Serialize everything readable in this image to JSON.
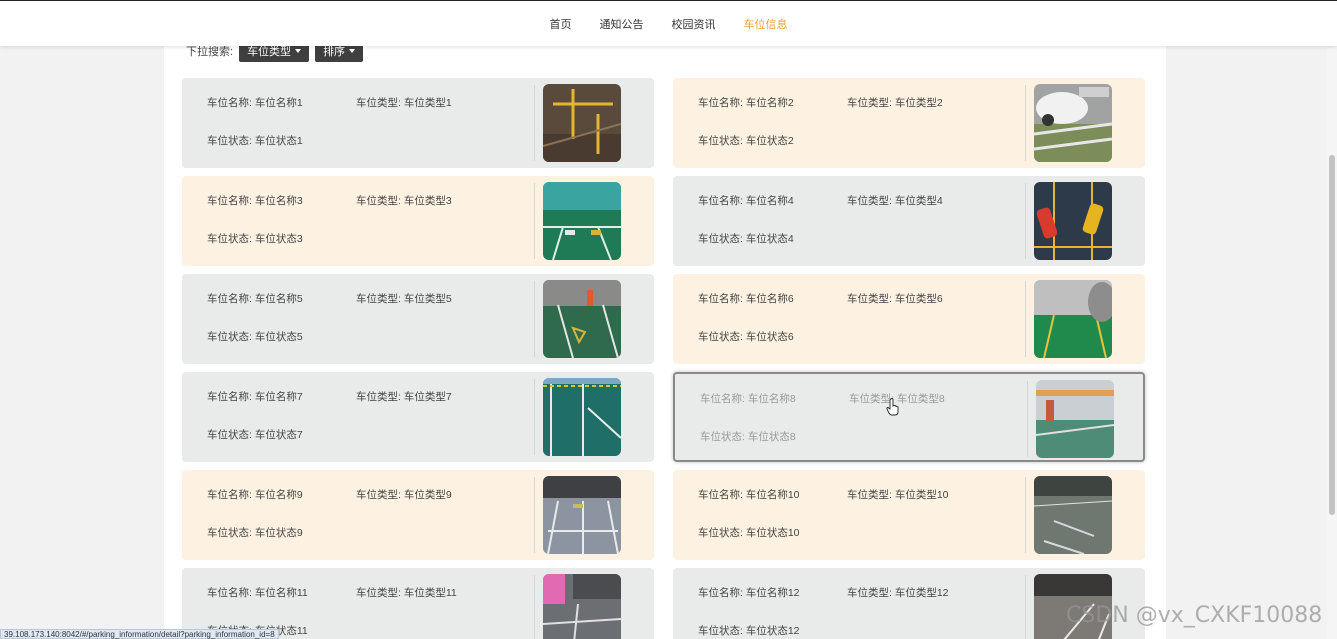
{
  "nav": {
    "items": [
      {
        "label": "首页",
        "active": false
      },
      {
        "label": "通知公告",
        "active": false
      },
      {
        "label": "校园资讯",
        "active": false
      },
      {
        "label": "车位信息",
        "active": true
      }
    ]
  },
  "filter": {
    "label": "下拉搜索:",
    "type_dropdown": "车位类型",
    "sort_dropdown": "排序"
  },
  "cards": [
    {
      "name": "车位名称: 车位名称1",
      "type": "车位类型: 车位类型1",
      "status": "车位状态: 车位状态1",
      "style": "gray",
      "thumb": "thumb1"
    },
    {
      "name": "车位名称: 车位名称2",
      "type": "车位类型: 车位类型2",
      "status": "车位状态: 车位状态2",
      "style": "cream",
      "thumb": "thumb2"
    },
    {
      "name": "车位名称: 车位名称3",
      "type": "车位类型: 车位类型3",
      "status": "车位状态: 车位状态3",
      "style": "cream",
      "thumb": "thumb3"
    },
    {
      "name": "车位名称: 车位名称4",
      "type": "车位类型: 车位类型4",
      "status": "车位状态: 车位状态4",
      "style": "gray",
      "thumb": "thumb4"
    },
    {
      "name": "车位名称: 车位名称5",
      "type": "车位类型: 车位类型5",
      "status": "车位状态: 车位状态5",
      "style": "gray",
      "thumb": "thumb5"
    },
    {
      "name": "车位名称: 车位名称6",
      "type": "车位类型: 车位类型6",
      "status": "车位状态: 车位状态6",
      "style": "cream",
      "thumb": "thumb6"
    },
    {
      "name": "车位名称: 车位名称7",
      "type": "车位类型: 车位类型7",
      "status": "车位状态: 车位状态7",
      "style": "gray",
      "thumb": "thumb7"
    },
    {
      "name": "车位名称: 车位名称8",
      "type": "车位类型: 车位类型8",
      "status": "车位状态: 车位状态8",
      "style": "gray hover",
      "thumb": "thumb8"
    },
    {
      "name": "车位名称: 车位名称9",
      "type": "车位类型: 车位类型9",
      "status": "车位状态: 车位状态9",
      "style": "cream",
      "thumb": "thumb9"
    },
    {
      "name": "车位名称: 车位名称10",
      "type": "车位类型: 车位类型10",
      "status": "车位状态: 车位状态10",
      "style": "cream",
      "thumb": "thumb10"
    },
    {
      "name": "车位名称: 车位名称11",
      "type": "车位类型: 车位类型11",
      "status": "车位状态: 车位状态11",
      "style": "gray",
      "thumb": "thumb11"
    },
    {
      "name": "车位名称: 车位名称12",
      "type": "车位类型: 车位类型12",
      "status": "车位状态: 车位状态12",
      "style": "gray",
      "thumb": "thumb12"
    }
  ],
  "statusbar": {
    "url": "39.108.173.140:8042/#/parking_information/detail?parking_information_id=8"
  },
  "watermark": "CSDN @vx_CXKF10088",
  "colors": {
    "accent": "#e8a23a",
    "card_gray": "#e9ebea",
    "card_cream": "#fdf2e2",
    "dropdown_bg": "#3f3f3f"
  }
}
